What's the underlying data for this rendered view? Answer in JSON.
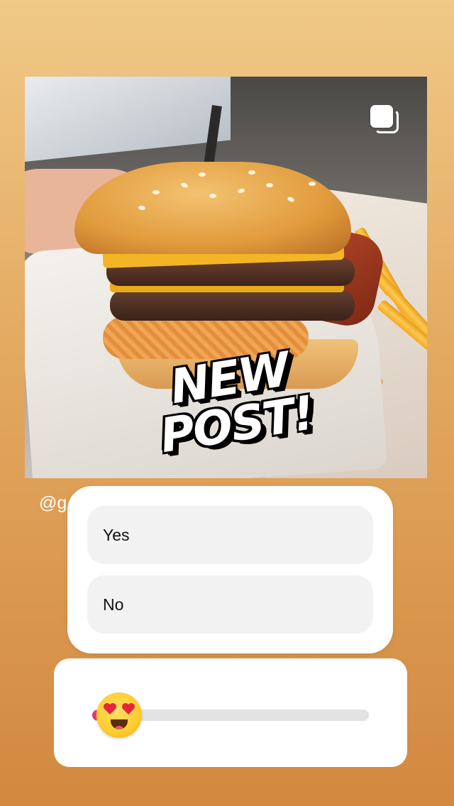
{
  "post": {
    "image_alt": "Burger with bacon, onion ring and fries",
    "sticker_line1": "NEW",
    "sticker_line2": "POST!",
    "multi_icon": "multiple-images-icon"
  },
  "mention": {
    "text": "@g"
  },
  "poll": {
    "options": [
      {
        "label": "Yes"
      },
      {
        "label": "No"
      }
    ]
  },
  "emoji_slider": {
    "emoji": "heart-eyes-emoji",
    "value": 0.02,
    "colors": {
      "track": "#e3e3e3",
      "fill_start": "#d62976",
      "fill_end": "#fa5a5a"
    }
  }
}
